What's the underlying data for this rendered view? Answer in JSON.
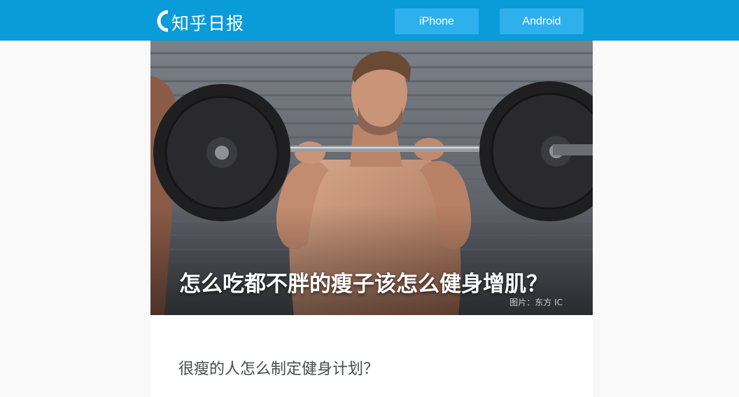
{
  "header": {
    "logo_text": "知乎日报",
    "buttons": [
      {
        "label": "iPhone"
      },
      {
        "label": "Android"
      }
    ]
  },
  "hero": {
    "title": "怎么吃都不胖的瘦子该怎么健身增肌？",
    "credit": "图片：东方 IC"
  },
  "content": {
    "question_title": "很瘦的人怎么制定健身计划？"
  },
  "colors": {
    "header_bg": "#0a9bd9",
    "button_bg": "#2db0ec",
    "page_bg": "#f9f9f9",
    "card_bg": "#ffffff"
  }
}
